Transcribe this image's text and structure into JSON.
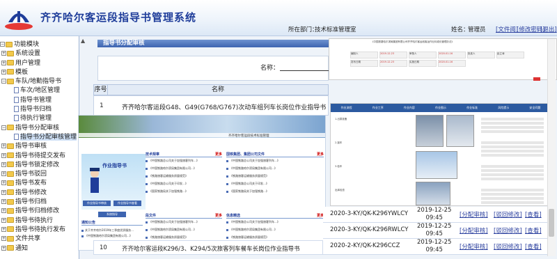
{
  "header": {
    "title": "齐齐哈尔客运段指导书管理系统",
    "department_label": "所在部门：",
    "department": "技术标准管理室",
    "user_label": "姓名：",
    "user": "管理员",
    "links": [
      "[文件阅]",
      "[修改密码]",
      "[退出]"
    ]
  },
  "sidebar": {
    "root": "功能模块",
    "items": [
      {
        "label": "系统设置",
        "type": "folder",
        "level": 1
      },
      {
        "label": "用户管理",
        "type": "folder",
        "level": 1
      },
      {
        "label": "模板",
        "type": "folder",
        "level": 1
      },
      {
        "label": "车队/地勤指导书",
        "type": "folder",
        "level": 1,
        "open": true
      },
      {
        "label": "车次/地区管理",
        "type": "doc",
        "level": 2
      },
      {
        "label": "指导书管理",
        "type": "doc",
        "level": 2
      },
      {
        "label": "指导书归档",
        "type": "doc",
        "level": 2
      },
      {
        "label": "待执行管理",
        "type": "doc",
        "level": 2
      },
      {
        "label": "指导书分配审核",
        "type": "folder",
        "level": 1,
        "open": true
      },
      {
        "label": "指导书分配审核管理",
        "type": "doc",
        "level": 2,
        "selected": true
      },
      {
        "label": "指导书审核",
        "type": "folder",
        "level": 1
      },
      {
        "label": "指导书待提交发布",
        "type": "folder",
        "level": 1
      },
      {
        "label": "指导书锁定修改",
        "type": "folder",
        "level": 1
      },
      {
        "label": "指导书驳回",
        "type": "folder",
        "level": 1
      },
      {
        "label": "指导书发布",
        "type": "folder",
        "level": 1
      },
      {
        "label": "指导书修改",
        "type": "folder",
        "level": 1
      },
      {
        "label": "指导书归档",
        "type": "folder",
        "level": 1
      },
      {
        "label": "指导书归档修改",
        "type": "folder",
        "level": 1
      },
      {
        "label": "指导书待执行",
        "type": "folder",
        "level": 1
      },
      {
        "label": "指导书待执行发布",
        "type": "folder",
        "level": 1
      },
      {
        "label": "文件共享",
        "type": "folder",
        "level": 1
      },
      {
        "label": "通知",
        "type": "folder",
        "level": 1
      }
    ]
  },
  "main": {
    "section_title": "指导书分配审核",
    "search_label": "名称：",
    "columns": [
      "序号",
      "名称"
    ],
    "first_row": {
      "index": "1",
      "name": "齐齐哈尔客运段G48、G49(G768/G767)次动车组列车长岗位作业指导书"
    },
    "last_row": {
      "index": "10",
      "name": "齐齐哈尔客运段K296/3、K294/5次旅客列车餐车长岗位作业指导书"
    },
    "rows": [
      {
        "code": "2020-3-KY/QK-K296YWLCY",
        "date": "2019-12-25",
        "time": "09:45"
      },
      {
        "code": "2020-3-KY/QK-K296RWLCY",
        "date": "2019-12-25",
        "time": "09:45"
      },
      {
        "code": "2020-2-KY/QK-K296CCZ",
        "date": "2019-12-25",
        "time": "09:45"
      }
    ],
    "actions": [
      "[分配审核]",
      "[驳回修改]",
      "[查看]"
    ]
  },
  "overlay_portal": {
    "banner_title": "齐齐哈尔客运段技术标准管理",
    "panel_titles": [
      "技术规章",
      "更多",
      "国铁集团、集团公司文件",
      "更多",
      "段文件",
      "更多",
      "信息精选",
      "更多"
    ],
    "mascot_label": "作业指导书",
    "buttons": [
      "作业指导书审核",
      "作业指导书查看",
      "系统指导"
    ],
    "news_title": "通知公告",
    "news": [
      "关于齐齐哈尔2019年三季度优质服务...",
      "《中国铁路哈尔滨局集团有限公司...》"
    ],
    "list_lines": [
      "《中国铁路总公司关于加强旅客列车...》",
      "《中国铁路哈尔滨局集团有限公司...》",
      "《铁路旅客运输服务质量规范》",
      "《中国铁路总公司关于印发...》",
      "《国家铁路局关于加强铁路...》"
    ]
  },
  "overlay_doc": {
    "rows": [
      [
        "编制人",
        "2019.12.23",
        "审核人",
        "2020.01.16",
        "批准人",
        "赵立涛"
      ],
      [
        "发布日期",
        "2019.12.23",
        "实施日期",
        "2020.01.16"
      ]
    ],
    "heading": "《中国铁路哈尔滨局集团有限公司齐齐哈尔客运段客运作业标准化管理办法》"
  },
  "overlay_instruction": {
    "columns": [
      "作业流程",
      "作业工序",
      "作业内容",
      "作业图示",
      "作业标准",
      "风险提示",
      "安全问题"
    ],
    "steps": [
      "1.出乘准备",
      "2.接车",
      "3.检车",
      "出库检查"
    ]
  },
  "colors": {
    "brand": "#1f3d9a",
    "section_bar": "#3d64b0",
    "link": "#2a3f9e"
  }
}
